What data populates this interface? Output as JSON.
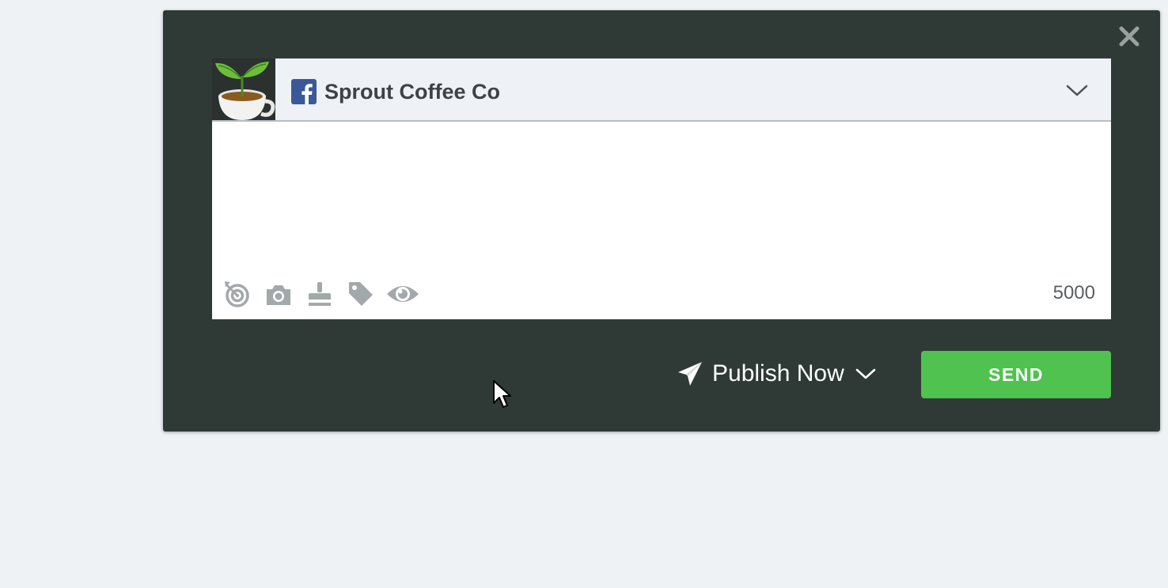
{
  "composer": {
    "profile": {
      "network_icon": "facebook-icon",
      "name": "Sprout Coffee Co",
      "avatar": "coffee-cup-sprout-logo"
    },
    "message": {
      "value": "",
      "placeholder": ""
    },
    "toolbar": [
      {
        "icon": "targeting-icon"
      },
      {
        "icon": "camera-icon"
      },
      {
        "icon": "stamp-icon"
      },
      {
        "icon": "tag-icon"
      },
      {
        "icon": "eye-icon"
      }
    ],
    "char_count": "5000"
  },
  "footer": {
    "publish_mode": "Publish Now",
    "send_label": "SEND"
  },
  "colors": {
    "modal_bg": "#2f3a36",
    "page_bg": "#eef2f5",
    "send_green": "#4fc24f",
    "facebook_blue": "#3b5998",
    "icon_gray": "#a3a8ab"
  }
}
